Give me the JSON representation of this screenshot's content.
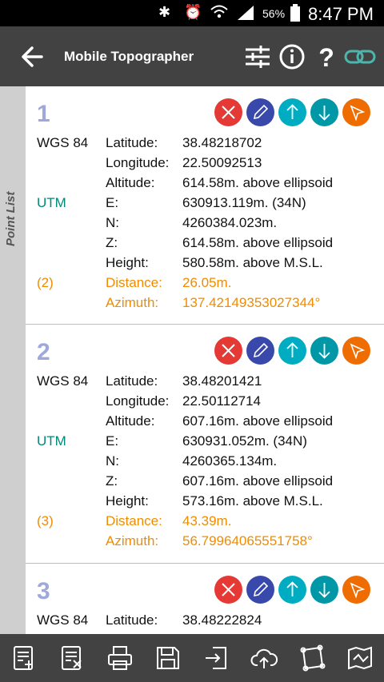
{
  "status_bar": {
    "icons": [
      "bluetooth-icon",
      "alarm-icon",
      "wifi-icon",
      "signal-icon",
      "battery-icon"
    ],
    "battery": "56%",
    "time": "8:47 PM"
  },
  "app_bar": {
    "title": "Mobile Topographer",
    "actions": [
      "back-arrow-icon",
      "sliders-icon",
      "info-icon",
      "help-icon",
      "link-icon"
    ],
    "colors": {
      "background": "#424242",
      "link_icon": "#4db6ac"
    }
  },
  "side_tab": {
    "label": "Point List"
  },
  "points": [
    {
      "number": "1",
      "wgs_label": "WGS 84",
      "latitude_label": "Latitude:",
      "latitude": "38.48218702",
      "longitude_label": "Longitude:",
      "longitude": "22.50092513",
      "altitude_label": "Altitude:",
      "altitude": "614.58m. above ellipsoid",
      "utm_label": "UTM",
      "e_label": "E:",
      "e": "630913.119m. (34N)",
      "n_label": "N:",
      "n": "4260384.023m.",
      "z_label": "Z:",
      "z": "614.58m. above ellipsoid",
      "height_label": "Height:",
      "height": "580.58m. above M.S.L.",
      "ref": "(2)",
      "distance_label": "Distance:",
      "distance": "26.05m.",
      "azimuth_label": "Azimuth:",
      "azimuth": "137.42149353027344°"
    },
    {
      "number": "2",
      "wgs_label": "WGS 84",
      "latitude_label": "Latitude:",
      "latitude": "38.48201421",
      "longitude_label": "Longitude:",
      "longitude": "22.50112714",
      "altitude_label": "Altitude:",
      "altitude": "607.16m. above ellipsoid",
      "utm_label": "UTM",
      "e_label": "E:",
      "e": "630931.052m. (34N)",
      "n_label": "N:",
      "n": "4260365.134m.",
      "z_label": "Z:",
      "z": "607.16m. above ellipsoid",
      "height_label": "Height:",
      "height": "573.16m. above M.S.L.",
      "ref": "(3)",
      "distance_label": "Distance:",
      "distance": "43.39m.",
      "azimuth_label": "Azimuth:",
      "azimuth": "56.79964065551758°"
    },
    {
      "number": "3",
      "wgs_label": "WGS 84",
      "latitude_label": "Latitude:",
      "latitude": "38.48222824"
    }
  ],
  "row_buttons": [
    "delete-icon",
    "edit-pencil-icon",
    "move-up-icon",
    "move-down-icon",
    "navigate-icon"
  ],
  "bottom_bar": {
    "icons": [
      "add-list-icon",
      "clear-list-icon",
      "print-icon",
      "save-icon",
      "export-icon",
      "cloud-upload-icon",
      "polygon-icon",
      "map-icon"
    ]
  },
  "colors": {
    "number": "#9fa8da",
    "utm": "#00897b",
    "orange": "#ef8c00",
    "delete": "#e53935",
    "edit": "#3949ab",
    "up": "#00acc1",
    "down": "#0097a7",
    "nav": "#ef6c00"
  }
}
